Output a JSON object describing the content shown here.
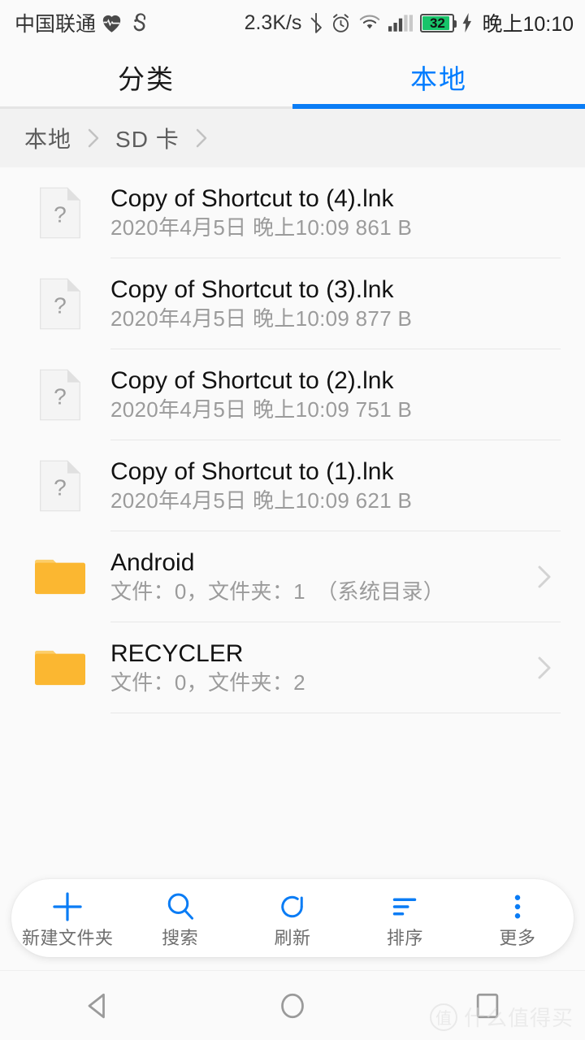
{
  "status_bar": {
    "carrier": "中国联通",
    "icons": [
      "heart-rate-icon",
      "uc-browser-icon",
      "bluetooth-icon",
      "alarm-icon",
      "wifi-icon",
      "signal-icon"
    ],
    "net_speed": "2.3K/s",
    "battery_level": "32",
    "battery_charging": true,
    "clock": "晚上10:10"
  },
  "tabs": {
    "items": [
      {
        "label": "分类",
        "active": false
      },
      {
        "label": "本地",
        "active": true
      }
    ],
    "active_color": "#0A7CF5"
  },
  "breadcrumb": {
    "items": [
      "本地",
      "SD 卡"
    ]
  },
  "list": {
    "rows": [
      {
        "type": "file",
        "icon": "unknown-file-icon",
        "name": "Copy of Shortcut to (4).lnk",
        "meta": "2020年4月5日 晚上10:09 861 B"
      },
      {
        "type": "file",
        "icon": "unknown-file-icon",
        "name": "Copy of Shortcut to (3).lnk",
        "meta": "2020年4月5日 晚上10:09 877 B"
      },
      {
        "type": "file",
        "icon": "unknown-file-icon",
        "name": "Copy of Shortcut to (2).lnk",
        "meta": "2020年4月5日 晚上10:09 751 B"
      },
      {
        "type": "file",
        "icon": "unknown-file-icon",
        "name": "Copy of Shortcut to (1).lnk",
        "meta": "2020年4月5日 晚上10:09 621 B"
      },
      {
        "type": "folder",
        "icon": "folder-icon",
        "name": "Android",
        "meta": "文件：0，文件夹：1　（系统目录）"
      },
      {
        "type": "folder",
        "icon": "folder-icon",
        "name": "RECYCLER",
        "meta": "文件：0，文件夹：2"
      }
    ]
  },
  "toolbar": {
    "items": [
      {
        "icon": "plus-icon",
        "label": "新建文件夹"
      },
      {
        "icon": "search-icon",
        "label": "搜索"
      },
      {
        "icon": "refresh-icon",
        "label": "刷新"
      },
      {
        "icon": "sort-icon",
        "label": "排序"
      },
      {
        "icon": "more-icon",
        "label": "更多"
      }
    ],
    "icon_color": "#0A7CF5"
  },
  "navbar": {
    "buttons": [
      "back-icon",
      "home-icon",
      "recents-icon"
    ]
  },
  "watermark": {
    "logo": "值",
    "text": "什么值得买"
  }
}
